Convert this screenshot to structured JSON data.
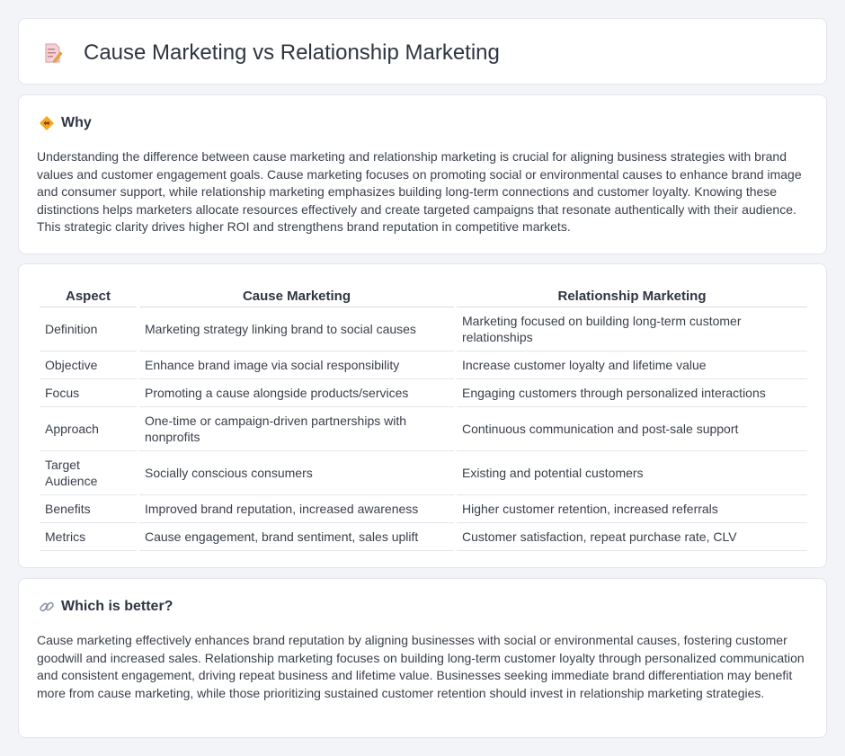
{
  "header": {
    "title": "Cause Marketing vs Relationship Marketing",
    "icon": "document-pencil-icon"
  },
  "why": {
    "heading": "Why",
    "icon": "diamond-arrows-icon",
    "text": "Understanding the difference between cause marketing and relationship marketing is crucial for aligning business strategies with brand values and customer engagement goals. Cause marketing focuses on promoting social or environmental causes to enhance brand image and consumer support, while relationship marketing emphasizes building long-term connections and customer loyalty. Knowing these distinctions helps marketers allocate resources effectively and create targeted campaigns that resonate authentically with their audience. This strategic clarity drives higher ROI and strengthens brand reputation in competitive markets."
  },
  "table": {
    "headers": [
      "Aspect",
      "Cause Marketing",
      "Relationship Marketing"
    ],
    "rows": [
      [
        "Definition",
        "Marketing strategy linking brand to social causes",
        "Marketing focused on building long-term customer relationships"
      ],
      [
        "Objective",
        "Enhance brand image via social responsibility",
        "Increase customer loyalty and lifetime value"
      ],
      [
        "Focus",
        "Promoting a cause alongside products/services",
        "Engaging customers through personalized interactions"
      ],
      [
        "Approach",
        "One-time or campaign-driven partnerships with nonprofits",
        "Continuous communication and post-sale support"
      ],
      [
        "Target Audience",
        "Socially conscious consumers",
        "Existing and potential customers"
      ],
      [
        "Benefits",
        "Improved brand reputation, increased awareness",
        "Higher customer retention, increased referrals"
      ],
      [
        "Metrics",
        "Cause engagement, brand sentiment, sales uplift",
        "Customer satisfaction, repeat purchase rate, CLV"
      ]
    ]
  },
  "better": {
    "heading": "Which is better?",
    "icon": "link-icon",
    "text": "Cause marketing effectively enhances brand reputation by aligning businesses with social or environmental causes, fostering customer goodwill and increased sales. Relationship marketing focuses on building long-term customer loyalty through personalized communication and consistent engagement, driving repeat business and lifetime value. Businesses seeking immediate brand differentiation may benefit more from cause marketing, while those prioritizing sustained customer retention should invest in relationship marketing strategies."
  }
}
